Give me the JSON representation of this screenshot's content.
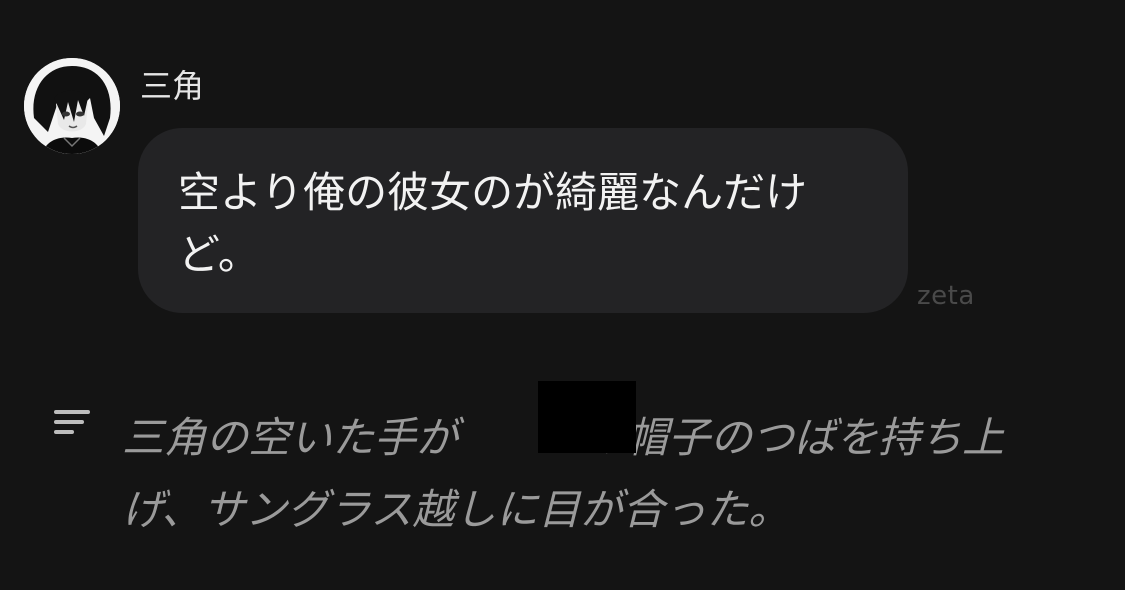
{
  "chat": {
    "sender": {
      "name": "三角",
      "avatar_icon": "character-portrait-icon"
    },
    "message": {
      "text": "空より俺の彼女のが綺麗なんだけど。"
    },
    "watermark": "zeta"
  },
  "narration": {
    "icon": "narration-lines-icon",
    "text": "三角の空いた手が　　　の帽子のつばを持ち上げ、サングラス越しに目が合った。",
    "redacted": true
  },
  "colors": {
    "background": "#141414",
    "bubble": "#232325",
    "message_text": "#f2f2f2",
    "narration_text": "#9a9a9a",
    "watermark": "#4a4a4a",
    "redaction": "#000000"
  }
}
